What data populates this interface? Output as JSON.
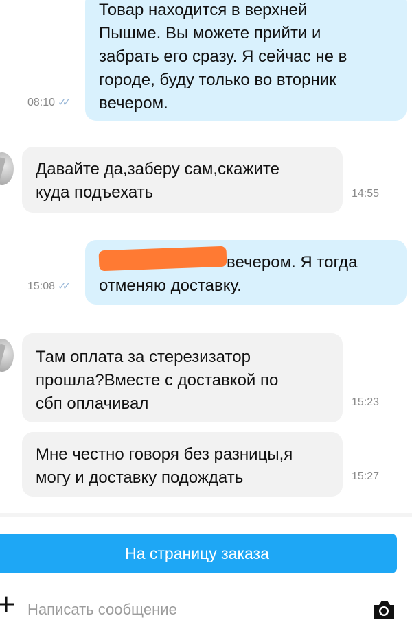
{
  "messages": [
    {
      "dir": "out",
      "text": "Товар находится в верхней\nПышме. Вы можете прийти и\nзабрать его сразу. Я сейчас не в\nгороде, буду только во вторник\nвечером.",
      "time": "08:10"
    },
    {
      "dir": "in",
      "text": "Давайте да,заберу сам,скажите\nкуда подъехать",
      "time": "14:55"
    },
    {
      "dir": "out",
      "text": "вечером. Я тогда\nотменяю доставку.",
      "time": "15:08"
    },
    {
      "dir": "in",
      "text": "Там оплата за стерезизатор\nпрошла?Вместе с доставкой по\nсбп оплачивал",
      "time": "15:23"
    },
    {
      "dir": "in",
      "text": "Мне честно говоря без разницы,я\nмогу и доставку подождать",
      "time": "15:27"
    }
  ],
  "read_check": "✓✓",
  "order_button": "На страницу заказа",
  "composer": {
    "placeholder": "Написать сообщение"
  },
  "colors": {
    "outgoing": "#d9f1fd",
    "incoming": "#f2f2f2",
    "accent": "#1ea7f5",
    "redaction": "#ff7a33"
  },
  "icons": {
    "attach": "plus-icon",
    "camera": "camera-icon",
    "read": "double-check-icon"
  }
}
